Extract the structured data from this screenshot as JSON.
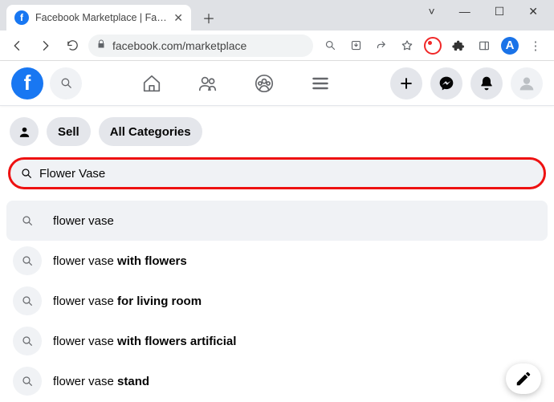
{
  "browser": {
    "tab_title": "Facebook Marketplace | Facebook",
    "url": "facebook.com/marketplace",
    "avatar_letter": "A"
  },
  "mp_bar": {
    "sell_label": "Sell",
    "categories_label": "All Categories"
  },
  "search": {
    "value": "Flower Vase"
  },
  "suggestions": [
    {
      "prefix": "flower vase",
      "bold": ""
    },
    {
      "prefix": "flower vase ",
      "bold": "with flowers"
    },
    {
      "prefix": "flower vase ",
      "bold": "for living room"
    },
    {
      "prefix": "flower vase ",
      "bold": "with flowers artificial"
    },
    {
      "prefix": "flower vase ",
      "bold": "stand"
    }
  ]
}
